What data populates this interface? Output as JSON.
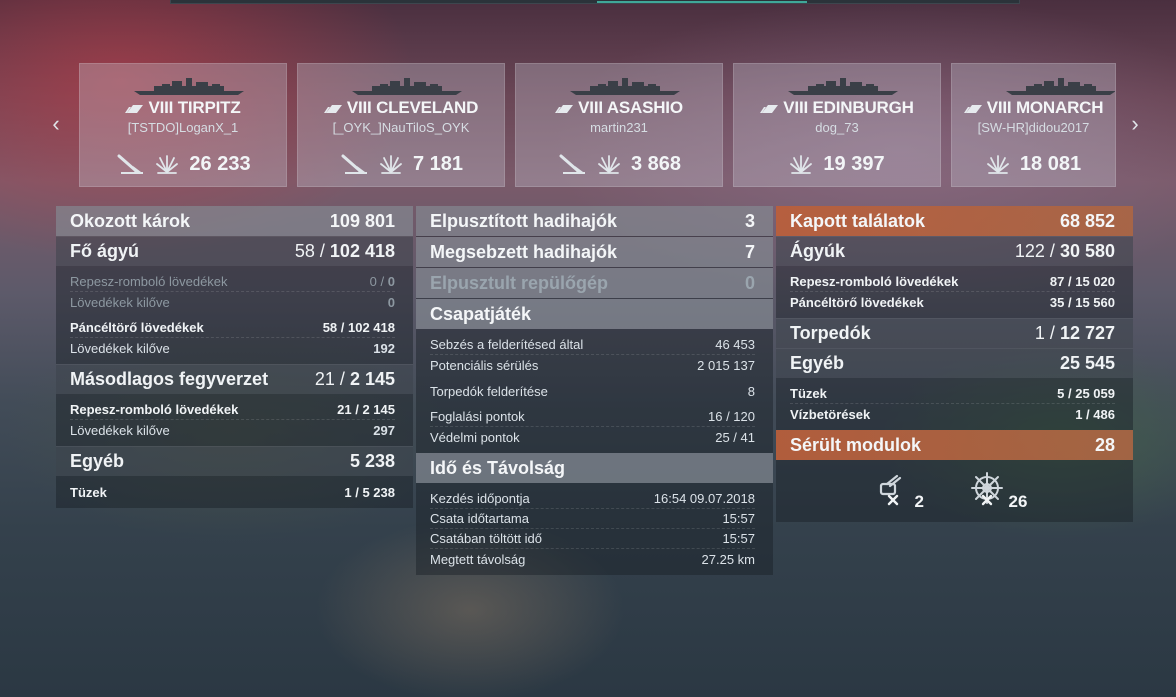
{
  "cards": [
    {
      "tier": "VIII",
      "name": "TIRPITZ",
      "player": "[TSTDO]LoganX_1",
      "torpedo": true,
      "damage": "26 233"
    },
    {
      "tier": "VIII",
      "name": "CLEVELAND",
      "player": "[_OYK_]NauTiloS_OYK",
      "torpedo": true,
      "damage": "7 181"
    },
    {
      "tier": "VIII",
      "name": "ASASHIO",
      "player": "martin231",
      "torpedo": true,
      "damage": "3 868"
    },
    {
      "tier": "VIII",
      "name": "EDINBURGH",
      "player": "dog_73",
      "torpedo": false,
      "damage": "19 397"
    },
    {
      "tier": "VIII",
      "name": "MONARCH",
      "player": "[SW-HR]didou2017",
      "torpedo": false,
      "damage": "18 081"
    }
  ],
  "left": {
    "title": "Okozott károk",
    "total": "109 801",
    "main": {
      "label": "Fő ágyú",
      "n": "58 /",
      "v": "102 418"
    },
    "main_rows": [
      {
        "label": "Repesz-romboló lövedékek",
        "n": "0 /",
        "v": "0"
      },
      {
        "label": "Lövedékek kilőve",
        "n": "",
        "v": "0"
      }
    ],
    "ap_rows": [
      {
        "label": "Páncéltörő lövedékek",
        "n": "58 /",
        "v": "102 418"
      },
      {
        "label": "Lövedékek kilőve",
        "n": "",
        "v": "192"
      }
    ],
    "secondary": {
      "label": "Másodlagos fegyverzet",
      "n": "21 /",
      "v": "2 145"
    },
    "secondary_rows": [
      {
        "label": "Repesz-romboló lövedékek",
        "n": "21 /",
        "v": "2 145"
      },
      {
        "label": "Lövedékek kilőve",
        "n": "",
        "v": "297"
      }
    ],
    "other": {
      "label": "Egyéb",
      "v": "5 238"
    },
    "other_rows": [
      {
        "label": "Tüzek",
        "n": "1 /",
        "v": "5 238"
      }
    ]
  },
  "middle": {
    "destroyed": {
      "label": "Elpusztított hadihajók",
      "v": "3"
    },
    "damaged": {
      "label": "Megsebzett hadihajók",
      "v": "7"
    },
    "planes": {
      "label": "Elpusztult repülőgép",
      "v": "0"
    },
    "team": {
      "label": "Csapatjáték"
    },
    "team_rows": [
      {
        "label": "Sebzés a felderítésed által",
        "v": "46 453"
      },
      {
        "label": "Potenciális sérülés",
        "v": "2 015 137"
      }
    ],
    "team_rows2": [
      {
        "label": "Torpedók felderítése",
        "v": "8"
      }
    ],
    "team_rows3": [
      {
        "label": "Foglalási pontok",
        "v": "16 / 120"
      },
      {
        "label": "Védelmi pontok",
        "v": "25 / 41"
      }
    ],
    "time": {
      "label": "Idő és Távolság"
    },
    "time_rows": [
      {
        "label": "Kezdés időpontja",
        "v": "16:54  09.07.2018"
      },
      {
        "label": "Csata időtartama",
        "v": "15:57"
      },
      {
        "label": "Csatában töltött idő",
        "v": "15:57"
      },
      {
        "label": "Megtett távolság",
        "v": "27.25 km"
      }
    ]
  },
  "right": {
    "title": "Kapott találatok",
    "total": "68 852",
    "guns": {
      "label": "Ágyúk",
      "n": "122 /",
      "v": "30 580"
    },
    "guns_rows": [
      {
        "label": "Repesz-romboló lövedékek",
        "n": "87 /",
        "v": "15 020"
      },
      {
        "label": "Páncéltörő lövedékek",
        "n": "35 /",
        "v": "15 560"
      }
    ],
    "torpedoes": {
      "label": "Torpedók",
      "n": "1 /",
      "v": "12 727"
    },
    "other": {
      "label": "Egyéb",
      "v": "25 545"
    },
    "other_rows": [
      {
        "label": "Tüzek",
        "n": "5 /",
        "v": "25 059"
      },
      {
        "label": "Vízbetörések",
        "n": "1 /",
        "v": "486"
      }
    ],
    "modules": {
      "label": "Sérült modulok",
      "v": "28"
    },
    "module_icons": [
      {
        "icon": "turret-icon",
        "count": "2"
      },
      {
        "icon": "steering-icon",
        "count": "26"
      }
    ]
  },
  "colors": {
    "accent_orange": "#c8643c",
    "teal": "#3fa899"
  }
}
